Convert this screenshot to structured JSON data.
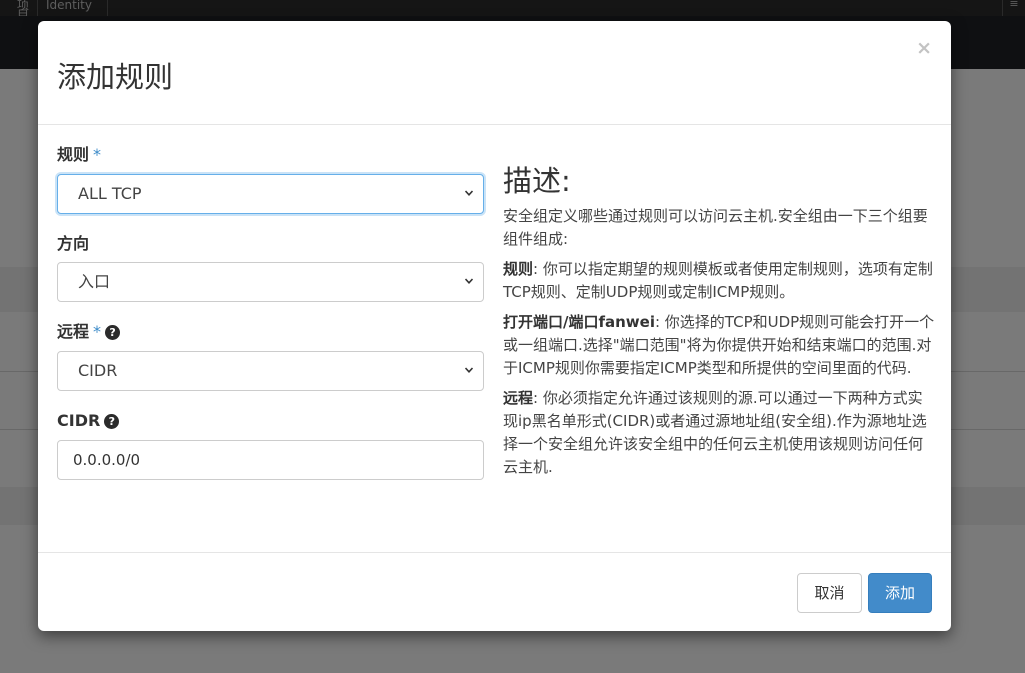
{
  "background": {
    "tabs": [
      "项目",
      "Identity"
    ],
    "menu_icon": "hamburger-icon"
  },
  "modal": {
    "title": "添加规则",
    "close_symbol": "×",
    "required_mark": "*",
    "help_symbol": "?",
    "fields": {
      "rule": {
        "label": "规则",
        "value": "ALL TCP"
      },
      "direction": {
        "label": "方向",
        "value": "入口"
      },
      "remote": {
        "label": "远程",
        "value": "CIDR"
      },
      "cidr": {
        "label": "CIDR",
        "value": "0.0.0.0/0"
      }
    },
    "description": {
      "title": "描述:",
      "intro": "安全组定义哪些通过规则可以访问云主机.安全组由一下三个组要组件组成:",
      "rule_term": "规则",
      "rule_text": ": 你可以指定期望的规则模板或者使用定制规则，选项有定制TCP规则、定制UDP规则或定制ICMP规则。",
      "port_term": "打开端口/端口fanwei",
      "port_text": ": 你选择的TCP和UDP规则可能会打开一个或一组端口.选择\"端口范围\"将为你提供开始和结束端口的范围.对于ICMP规则你需要指定ICMP类型和所提供的空间里面的代码.",
      "remote_term": "远程",
      "remote_text": ": 你必须指定允许通过该规则的源.可以通过一下两种方式实现ip黑名单形式(CIDR)或者通过源地址组(安全组).作为源地址选择一个安全组允许该安全组中的任何云主机使用该规则访问任何云主机."
    },
    "buttons": {
      "cancel": "取消",
      "add": "添加"
    }
  },
  "colors": {
    "primary": "#428bca",
    "required": "#3b8ac8",
    "focus": "#66afe9"
  }
}
